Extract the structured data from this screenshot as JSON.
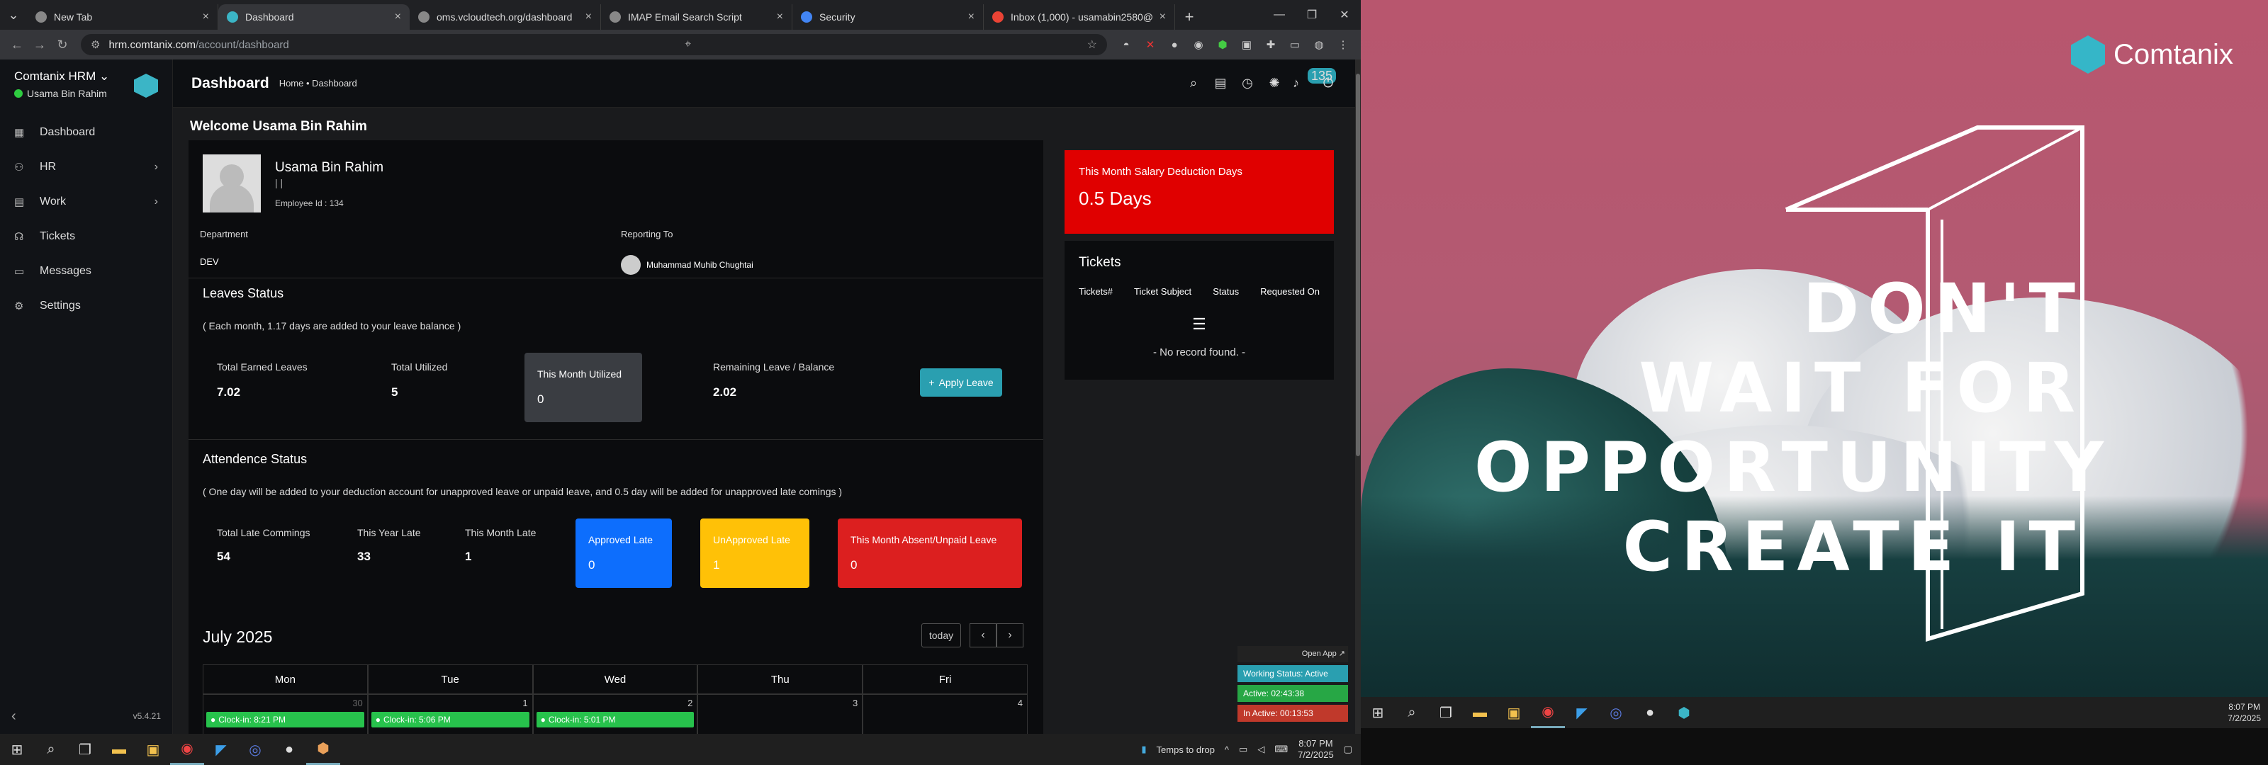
{
  "browser": {
    "tabs": [
      {
        "title": "New Tab",
        "favicon_color": "#888888"
      },
      {
        "title": "Dashboard",
        "favicon_color": "#3bb5c6"
      },
      {
        "title": "oms.vcloudtech.org/dashboard",
        "favicon_color": "#888888"
      },
      {
        "title": "IMAP Email Search Script",
        "favicon_color": "#888888"
      },
      {
        "title": "Security",
        "favicon_color": "#4285f4"
      },
      {
        "title": "Inbox (1,000) - usamabin2580@",
        "favicon_color": "#ea4335"
      }
    ],
    "url_domain": "hrm.comtanix.com",
    "url_path": "/account/dashboard"
  },
  "sidebar": {
    "app_name": "Comtanix HRM",
    "user": "Usama Bin Rahim",
    "items": [
      {
        "label": "Dashboard",
        "icon": "dashboard-icon"
      },
      {
        "label": "HR",
        "icon": "users-icon"
      },
      {
        "label": "Work",
        "icon": "briefcase-icon"
      },
      {
        "label": "Tickets",
        "icon": "headset-icon"
      },
      {
        "label": "Messages",
        "icon": "chat-icon"
      },
      {
        "label": "Settings",
        "icon": "gear-icon"
      }
    ],
    "version": "v5.4.21"
  },
  "header": {
    "title": "Dashboard",
    "breadcrumb": "Home • Dashboard",
    "notification_count": "135"
  },
  "welcome": "Welcome Usama Bin Rahim",
  "profile": {
    "name": "Usama Bin Rahim",
    "sub": "| |",
    "employee_id": "Employee Id : 134",
    "department_label": "Department",
    "department": "DEV",
    "reporting_label": "Reporting To",
    "reporting_to": "Muhammad Muhib Chughtai"
  },
  "leaves": {
    "title": "Leaves Status",
    "note": "( Each month, 1.17 days are added to your leave balance )",
    "total_earned_label": "Total Earned Leaves",
    "total_earned": "7.02",
    "total_utilized_label": "Total Utilized",
    "total_utilized": "5",
    "this_month_label": "This Month Utilized",
    "this_month": "0",
    "remaining_label": "Remaining Leave / Balance",
    "remaining": "2.02",
    "apply_label": "Apply Leave"
  },
  "attendance": {
    "title": "Attendence Status",
    "note": "( One day will be added to your deduction account for unapproved leave or unpaid leave, and 0.5 day will be added for unapproved late comings )",
    "late_total_label": "Total Late Commings",
    "late_total": "54",
    "year_late_label": "This Year Late",
    "year_late": "33",
    "month_late_label": "This Month Late",
    "month_late": "1",
    "approved_label": "Approved Late",
    "approved": "0",
    "unapproved_label": "UnApproved Late",
    "unapproved": "1",
    "absent_label": "This Month Absent/Unpaid Leave",
    "absent": "0"
  },
  "calendar": {
    "month": "July 2025",
    "today_label": "today",
    "days": [
      "Mon",
      "Tue",
      "Wed",
      "Thu",
      "Fri"
    ],
    "dates": [
      "30",
      "1",
      "2",
      "3",
      "4"
    ],
    "events": [
      "Clock-in: 8:21 PM",
      "Clock-in: 5:06 PM",
      "Clock-in: 5:01 PM"
    ]
  },
  "salary": {
    "title": "This Month Salary Deduction Days",
    "value": "0.5 Days"
  },
  "tickets": {
    "title": "Tickets",
    "cols": [
      "Tickets#",
      "Ticket Subject",
      "Status",
      "Requested On"
    ],
    "empty": "- No record found. -"
  },
  "widget": {
    "open_app": "Open App ↗",
    "status": "Working Status: Active",
    "active": "Active: 02:43:38",
    "inactive": "In Active: 00:13:53"
  },
  "taskbar": {
    "tray_text": "Temps to drop",
    "time": "8:07 PM",
    "date": "7/2/2025"
  },
  "wallpaper": {
    "brand": "Comtanix",
    "line1": "DON'T",
    "line2": "WAIT FOR",
    "line3": "OPPORTUNITY",
    "line4": "CREATE IT"
  },
  "colors": {
    "accent": "#2a9fb0",
    "danger": "#e00000",
    "approved": "#0d6efd",
    "unapproved": "#ffc107",
    "absent": "#dc1f1f",
    "success": "#27c24c"
  }
}
